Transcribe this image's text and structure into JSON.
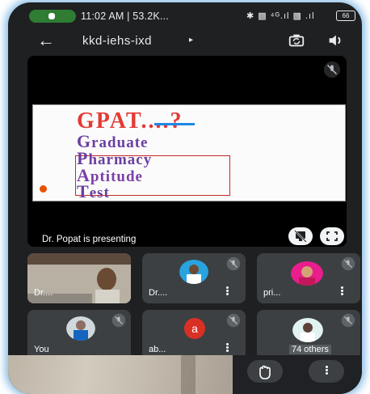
{
  "status_bar": {
    "time_and_data": "11:02 AM | 53.2K...",
    "network_icons": "✱ ▩ ⁴ᴳ.ıl ▩ .ıl",
    "battery": "66"
  },
  "app_bar": {
    "title": "kkd-iehs-ixd",
    "caret": "▸",
    "back_icon": "←"
  },
  "presentation": {
    "label": "Dr. Popat is presenting",
    "slide": {
      "title": "GPAT....?",
      "lines": [
        {
          "first": "G",
          "rest": "raduate",
          "color": "#6a3fa0"
        },
        {
          "first": "P",
          "rest": "harmacy",
          "color": "#6a3fa0"
        },
        {
          "first": "A",
          "rest": "ptitude",
          "color": "#7b3fa8"
        },
        {
          "first": "T",
          "rest": "est",
          "color": "#6a3fa0"
        }
      ]
    }
  },
  "participants": [
    {
      "name": "Dr....",
      "kind": "video"
    },
    {
      "name": "Dr....",
      "kind": "avatar-photo"
    },
    {
      "name": "pri...",
      "kind": "avatar-photo"
    },
    {
      "name": "You",
      "kind": "avatar-photo"
    },
    {
      "name": "ab...",
      "kind": "letter",
      "letter": "a"
    },
    {
      "name": "74 others",
      "kind": "avatar-photo"
    }
  ],
  "colors": {
    "background": "#1f2022",
    "tile": "#3c4043",
    "glow": "#2b87d2",
    "mic_active": "#2e7d32",
    "letter_avatar": "#d93025"
  },
  "icons": {
    "more": "vertical-dots-icon",
    "muted": "mic-off-icon",
    "raise_hand": "hand-icon",
    "fullscreen": "fullscreen-icon",
    "stop_presenting": "present-off-icon"
  }
}
